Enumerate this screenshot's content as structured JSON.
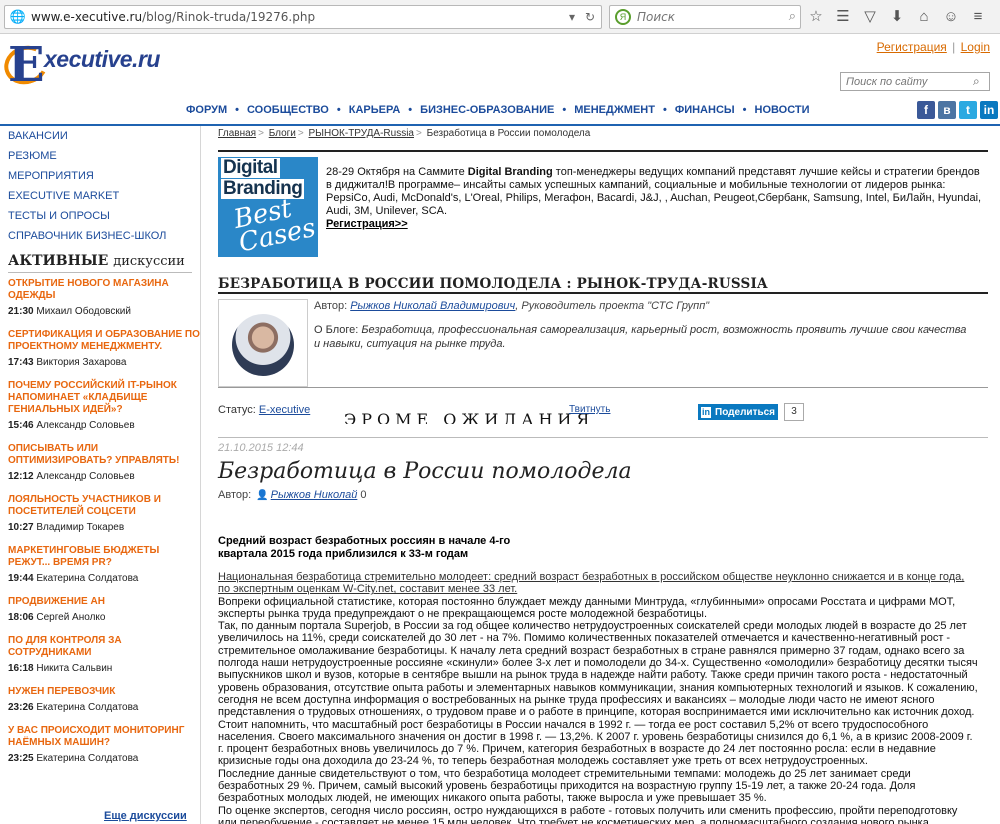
{
  "browser": {
    "url_host": "www.e-xecutive.ru",
    "url_path": "/blog/Rinok-truda/19276.php",
    "search_placeholder": "Поиск"
  },
  "header": {
    "logo_text": "E-xecutive.ru",
    "register_label": "Регистрация",
    "login_label": "Login",
    "site_search_placeholder": "Поиск по сайту"
  },
  "nav": {
    "items": [
      "ФОРУМ",
      "СООБЩЕСТВО",
      "КАРЬЕРА",
      "БИЗНЕС-ОБРАЗОВАНИЕ",
      "МЕНЕДЖМЕНТ",
      "ФИНАНСЫ",
      "НОВОСТИ"
    ]
  },
  "social": [
    "facebook-icon",
    "vk-icon",
    "twitter-icon",
    "linkedin-icon"
  ],
  "sidebar": {
    "menu": [
      "ВАКАНСИИ",
      "РЕЗЮМЕ",
      "МЕРОПРИЯТИЯ",
      "EXECUTIVE MARKET",
      "ТЕСТЫ И ОПРОСЫ",
      "СПРАВОЧНИК БИЗНЕС-ШКОЛ"
    ],
    "active_title_a": "АКТИВНЫЕ",
    "active_title_b": "дискуссии",
    "discussions": [
      {
        "title": "ОТКРЫТИЕ НОВОГО МАГАЗИНА ОДЕЖДЫ",
        "time": "21:30",
        "author": "Михаил Ободовский"
      },
      {
        "title": "СЕРТИФИКАЦИЯ И ОБРАЗОВАНИЕ ПО ПРОЕКТНОМУ МЕНЕДЖМЕНТУ.",
        "time": "17:43",
        "author": "Виктория Захарова"
      },
      {
        "title": "ПОЧЕМУ РОССИЙСКИЙ IT-РЫНОК НАПОМИНАЕТ «КЛАДБИЩЕ ГЕНИАЛЬНЫХ ИДЕЙ»?",
        "time": "15:46",
        "author": "Александр Соловьев"
      },
      {
        "title": "ОПИСЫВАТЬ ИЛИ ОПТИМИЗИРОВАТЬ? УПРАВЛЯТЬ!",
        "time": "12:12",
        "author": "Александр Соловьев"
      },
      {
        "title": "ЛОЯЛЬНОСТЬ УЧАСТНИКОВ И ПОСЕТИТЕЛЕЙ СОЦСЕТИ",
        "time": "10:27",
        "author": "Владимир Токарев"
      },
      {
        "title": "МАРКЕТИНГОВЫЕ БЮДЖЕТЫ РЕЖУТ... ВРЕМЯ PR?",
        "time": "19:44",
        "author": "Екатерина Солдатова"
      },
      {
        "title": "ПРОДВИЖЕНИЕ АН",
        "time": "18:06",
        "author": "Сергей Анолко"
      },
      {
        "title": "ПО ДЛЯ КОНТРОЛЯ ЗА СОТРУДНИКАМИ",
        "time": "16:18",
        "author": "Никита Сальвин"
      },
      {
        "title": "НУЖЕН ПЕРЕВОЗЧИК",
        "time": "23:26",
        "author": "Екатерина Солдатова"
      },
      {
        "title": "У ВАС ПРОИСХОДИТ МОНИТОРИНГ НАЁМНЫХ МАШИН?",
        "time": "23:25",
        "author": "Екатерина Солдатова"
      }
    ],
    "more_label": "Еще дискуссии"
  },
  "breadcrumbs": [
    "Главная",
    "Блоги",
    "РЫНОК-ТРУДА-Russia",
    "Безработица в России помолодела"
  ],
  "banner": {
    "img_line1": "Digital",
    "img_line2": "Branding",
    "img_line3": "Best",
    "img_line4": "Cases",
    "text_a": "28-29 Октября на Саммите ",
    "text_b": "Digital Branding",
    "text_c": " топ-менеджеры ведущих компаний представят лучшие кейсы и стратегии брендов в диджитал!В программе– инсайты самых успешных кампаний, социальные и мобильные технологии от лидеров рынка: PepsiCo, Audi, McDonald's, L'Oreal, Philips, Мегафон, Bacardi, J&J, , Auchan, Peugeot,Сбербанк, Samsung, Intel, БиЛайн, Hyundai, Audi, 3M, Unilever, SCA.",
    "link": "Регистрация>>"
  },
  "blog": {
    "title": "БЕЗРАБОТИЦА В РОССИИ ПОМОЛОДЕЛА : РЫНОК-ТРУДА-RUSSIA",
    "author_label": "Автор: ",
    "author_name": "Рыжков Николай Владимирович",
    "author_role": ", Руководитель проекта \"СТС Групп\"",
    "about_label": "О Блоге: ",
    "about_text": "Безработица, профессиональная самореализация, карьерный рост, возможность проявить лучшие свои качества и навыки, ситуация на рынке труда."
  },
  "status": {
    "label": "Статус: ",
    "value": "E-xecutive",
    "ghost_text": "ЭРОМЕ ОЖИДАНИЯ",
    "tweet": "Твитнуть",
    "share_label": "Поделиться",
    "share_count": "3"
  },
  "post": {
    "date": "21.10.2015  12:44",
    "title": "Безработица в России помолодела",
    "author_label": "Автор:",
    "author_name": "Рыжков Николай",
    "author_count": "0",
    "lead": "Средний возраст безработных россиян в начале 4-го квартала 2015 года приблизился к 33-м годам",
    "paragraphs": [
      "Национальная безработица стремительно молодеет: средний возраст безработных в российском обществе неуклонно снижается и в конце года, по экспертным оценкам W-City.net, составит менее 33 лет.",
      "Вопреки официальной статистике, которая постоянно блуждает между данными Минтруда, «глубинными» опросами Росстата и цифрами МОТ, эксперты рынка труда предупреждают о не прекращающемся росте молодежной безработицы.",
      "Так, по данным портала Superjob, в России за год общее количество нетрудоустроенных соискателей среди молодых людей в возрасте до 25 лет увеличилось на 11%, среди соискателей до 30 лет - на 7%. Помимо количественных показателей отмечается и качественно-негативный рост - стремительное омолаживание безработицы. К началу лета средний возраст безработных в стране равнялся примерно 37 годам, однако всего за полгода наши нетрудоустроенные россияне «скинули» более 3-х лет и помолодели до 34-х. Существенно «омолодили» безработицу десятки тысяч выпускников школ и вузов, которые в сентябре вышли на рынок труда в надежде найти работу. Также среди причин такого роста - недостаточный уровень образования, отсутствие опыта работы и элементарных навыков коммуникации, знания компьютерных технологий и языков. К сожалению, сегодня не всем доступна информация о востребованных на рынке труда профессиях и вакансиях – молодые люди часто не имеют ясного представления о трудовых отношениях, о трудовом праве и о работе в принципе, которая воспринимается ими исключительно как источник доход.",
      "Стоит напомнить, что масштабный рост безработицы в России начался в 1992 г. — тогда ее рост составил 5,2% от всего трудоспособного населения. Своего максимального значения он достиг в 1998 г. — 13,2%. К 2007 г. уровень безработицы снизился до 6,1 %, а в кризис 2008-2009 г. г. процент безработных вновь увеличилось до 7 %. Причем, категория безработных в возрасте до 24 лет постоянно росла: если в недавние кризисные годы она доходила до 23-24 %, то теперь безработная молодежь составляет уже треть от всех нетрудоустроенных.",
      "Последние данные свидетельствуют о том, что безработица молодеет стремительными темпами: молодежь до 25 лет занимает среди безработных 29 %. Причем, самый высокий уровень безработицы приходится на возрастную группу 15-19 лет, а также 20-24 года. Доля безработных молодых людей, не имеющих никакого опыта работы, также выросла и уже превышает 35 %.",
      "По оценке экспертов, сегодня число россиян, остро нуждающихся в работе - готовых получить или сменить профессию, пройти переподготовку или переобучение - составляет не менее 15 млн человек. Что требует не косметических мер, а полномасштабного создания нового рынка образовательных услуг для населения - не только для вступающих в трудовую жизнь, но и уже имеющих ее позитивный или негативный опыт."
    ]
  },
  "colors": {
    "accent_orange": "#e8670f",
    "link_blue": "#1b4b9b",
    "rule_blue": "#1f63b1"
  }
}
